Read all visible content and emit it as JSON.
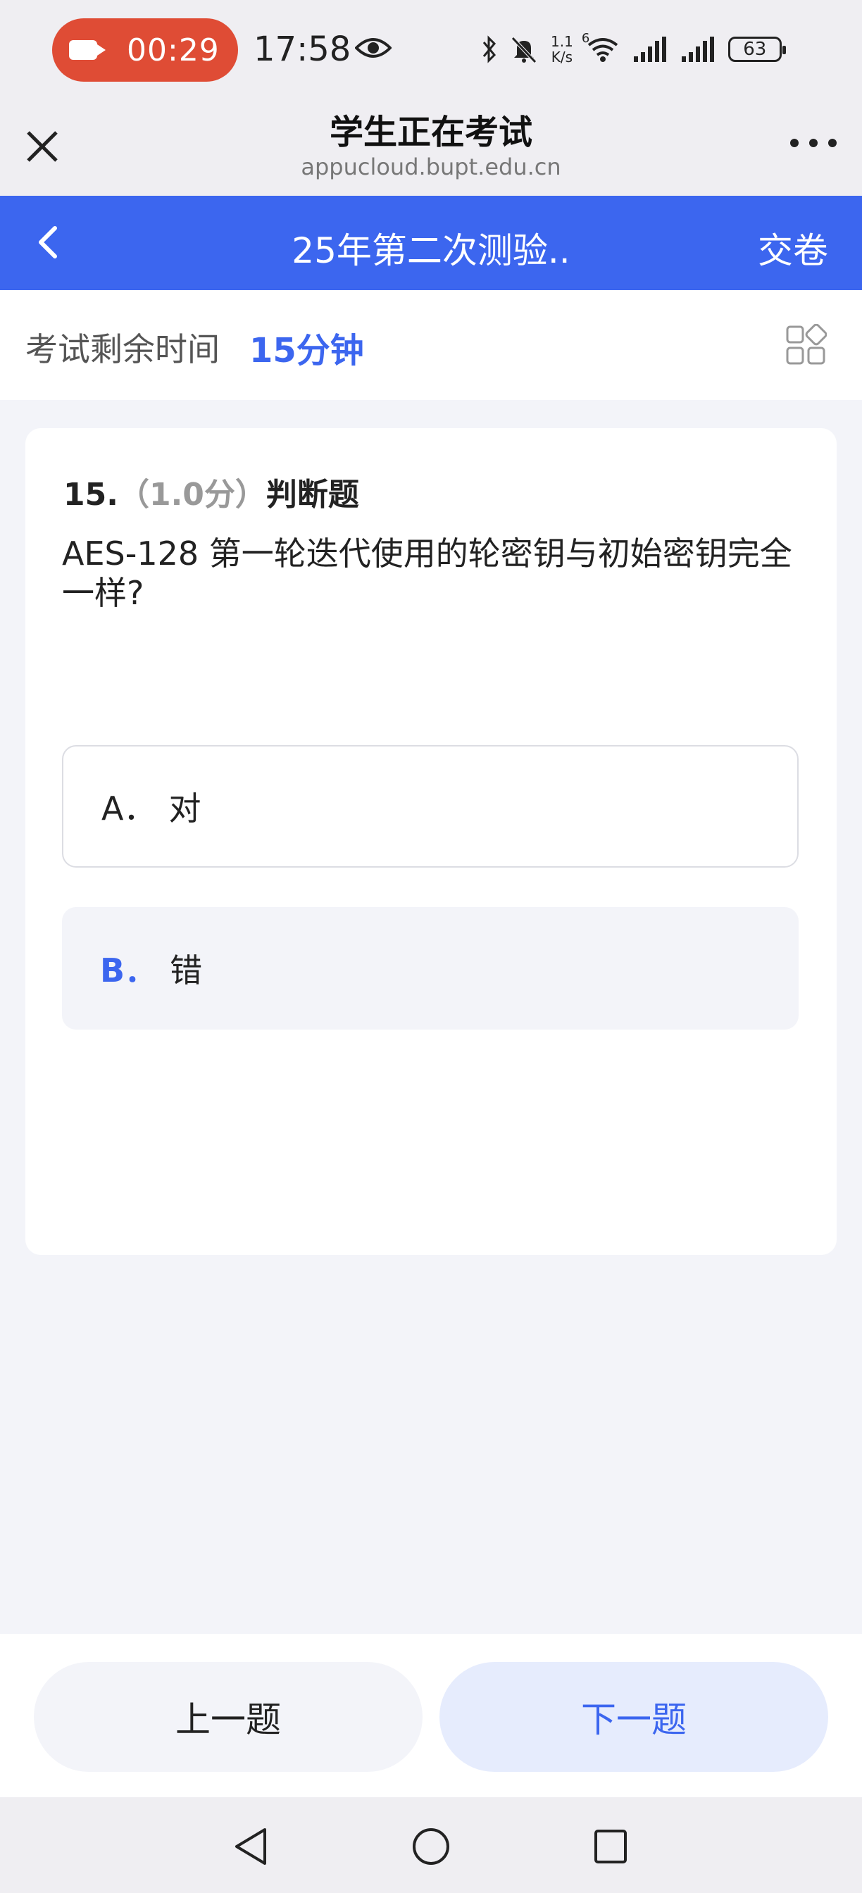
{
  "status_bar": {
    "recording_time": "00:29",
    "clock": "17:58",
    "net_speed_value": "1.1",
    "net_speed_unit": "K/s",
    "wifi_badge": "6",
    "battery": "63",
    "icons": [
      "camera-icon",
      "eye-icon",
      "bluetooth-icon",
      "mute-icon",
      "wifi-icon",
      "signal-icon",
      "signal-icon",
      "battery-icon"
    ]
  },
  "browser": {
    "title": "学生正在考试",
    "url": "appucloud.bupt.edu.cn"
  },
  "nav": {
    "title": "25年第二次测验..",
    "submit_label": "交卷"
  },
  "timer": {
    "label": "考试剩余时间",
    "value": "15分钟"
  },
  "question": {
    "number": "15.",
    "score": "（1.0分）",
    "type": "判断题",
    "text": "AES-128 第一轮迭代使用的轮密钥与初始密钥完全一样?",
    "options": [
      {
        "letter": "A．",
        "label": "对",
        "selected": false
      },
      {
        "letter": "B．",
        "label": "错",
        "selected": true
      }
    ]
  },
  "actions": {
    "prev_label": "上一题",
    "next_label": "下一题"
  },
  "colors": {
    "accent": "#3c66ef",
    "recording": "#df4c35"
  }
}
